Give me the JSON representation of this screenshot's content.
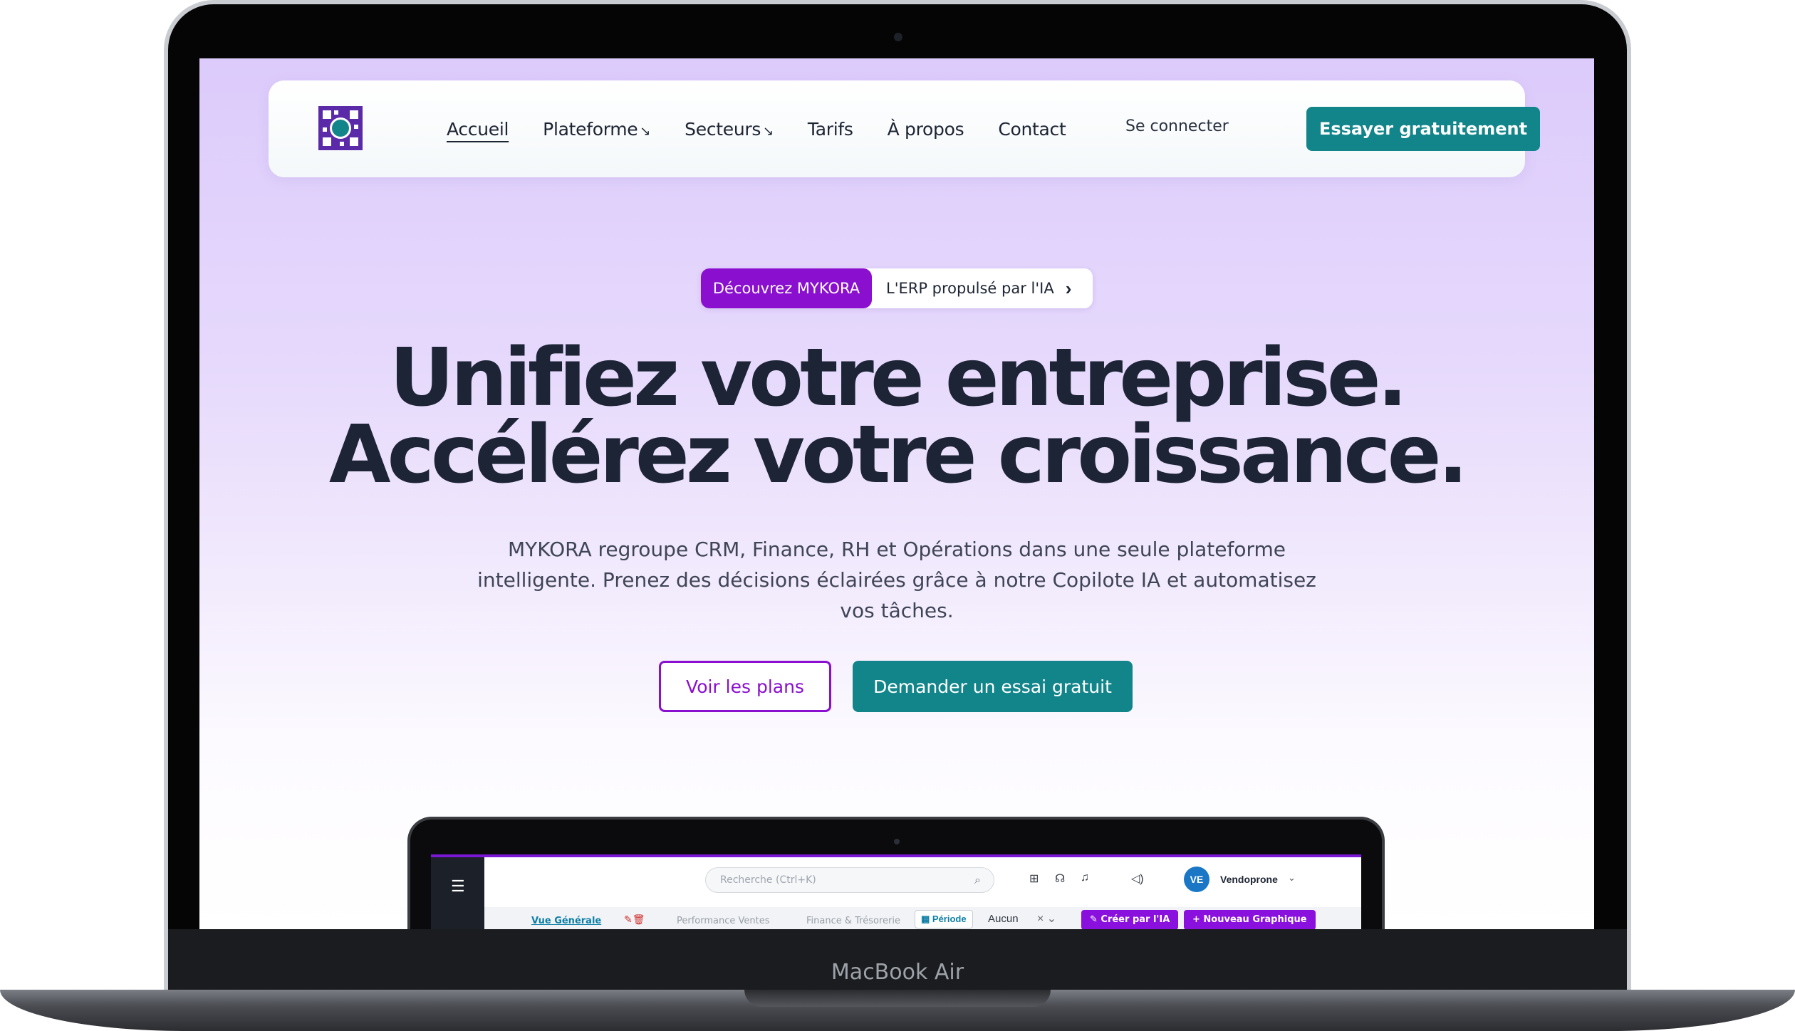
{
  "device": {
    "brand_label": "MacBook Air"
  },
  "colors": {
    "accent_purple": "#8a0fcf",
    "accent_teal": "#12858a",
    "text_dark": "#1d2436"
  },
  "nav": {
    "links": [
      {
        "label": "Accueil",
        "active": true
      },
      {
        "label": "Plateforme",
        "arrow": "↘"
      },
      {
        "label": "Secteurs",
        "arrow": "↘"
      },
      {
        "label": "Tarifs"
      },
      {
        "label": "À propos"
      },
      {
        "label": "Contact"
      }
    ],
    "login_label": "Se connecter",
    "cta_label": "Essayer gratuitement"
  },
  "announcement": {
    "tag": "Découvrez MYKORA",
    "text": "L'ERP propulsé par l'IA",
    "chevron": "›"
  },
  "hero": {
    "title_line1": "Unifiez votre entreprise.",
    "title_line2": "Accélérez votre croissance.",
    "subtitle": "MYKORA regroupe CRM, Finance, RH et Opérations dans une seule plateforme intelligente. Prenez des décisions éclairées grâce à notre Copilote IA et automatisez vos tâches.",
    "secondary_button": "Voir les plans",
    "primary_button": "Demander un essai gratuit"
  },
  "app_preview": {
    "search_placeholder": "Recherche (Ctrl+K)",
    "avatar_initials": "VE",
    "user_name": "Vendoprone",
    "tabs": [
      "Vue Générale",
      "Performance Ventes",
      "Finance & Trésorerie"
    ],
    "period_label": "Période",
    "period_value": "Aucun",
    "buttons": [
      "✎ Créer par l'IA",
      "+ Nouveau Graphique"
    ]
  }
}
